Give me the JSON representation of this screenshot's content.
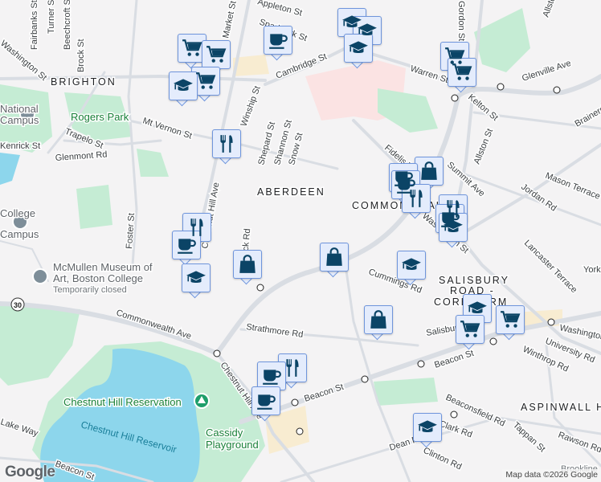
{
  "neighborhoods": {
    "brighton": "BRIGHTON",
    "aberdeen": "ABERDEEN",
    "commonwealth": "COMMONWEALTH",
    "salisbury_1": "SALISBURY",
    "salisbury_2": "ROAD -",
    "salisbury_3": "CORE FARM",
    "aspinwall": "ASPINWALL HILL",
    "brookline": "Brookline"
  },
  "streets": {
    "fairbanks": "Fairbanks St",
    "turner": "Turner St",
    "beechcroft": "Beechcroft St",
    "brock": "Brock St",
    "market": "Market St",
    "sparhawk": "Sparhawk St",
    "appleton": "Appleton St",
    "cambridge": "Cambridge St",
    "warren": "Warren St",
    "gordon": "Gordon St",
    "allston_top": "Allston St",
    "glenville": "Glenville Ave",
    "kelton": "Kelton St",
    "brainerd": "Brainerd Rd",
    "allston": "Allston St",
    "summit": "Summit Ave",
    "mason": "Mason Terrace",
    "jordan": "Jordan Rd",
    "lancaster": "Lancaster Terrace",
    "york": "York Ter",
    "washington": "Washington St",
    "washington2": "Washington St",
    "university": "University Rd",
    "winthrop": "Winthrop Rd",
    "tappan": "Tappan St",
    "rawson": "Rawson Rd",
    "beaconsfield": "Beaconsfield Rd",
    "dean": "Dean Rd",
    "clark": "Clark Rd",
    "clinton": "Clinton Rd",
    "beacon1": "Beacon St",
    "beacon2": "Beacon St",
    "beacon3": "Beacon St",
    "cummings": "Cummings Rd",
    "salisbury_rd": "Salisbury Rd",
    "strathmore": "Strathmore Rd",
    "commonwealth_ave": "Commonwealth Ave",
    "chestnut_hill_ave": "Chestnut Hill Ave",
    "chestnut_hill_ave2": "Chestnut Hill Ave",
    "winship": "Winship St",
    "shepard": "Shepard St",
    "shannon": "Shannon St",
    "snow": "Snow St",
    "mt_vernon": "Mt Vernon St",
    "trapelo": "Trapelo St",
    "kenrick": "Kenrick St",
    "glenmont": "Glenmont Rd",
    "foster": "Foster St",
    "washington_st_left": "Washington St",
    "chiswick": "Chiswick Rd",
    "fidelis": "Fidelis Way",
    "route": "30",
    "lake_way": "Lake Way"
  },
  "pois": {
    "rogers_park": "Rogers Park",
    "mcmullen_1": "McMullen Museum of",
    "mcmullen_2": "Art, Boston College",
    "mcmullen_status": "Temporarily closed",
    "reservation": "Chestnut Hill Reservation",
    "reservoir": "Chestnut Hill Reservoir",
    "cassidy_1": "Cassidy",
    "cassidy_2": "Playground",
    "campus1_a": "National",
    "campus1_b": "Campus",
    "campus2_a": "College",
    "campus2_b": "Campus"
  },
  "markers": [
    "cart",
    "cart",
    "cart",
    "graduation-cap",
    "coffee",
    "restaurant",
    "graduation-cap",
    "graduation-cap",
    "graduation-cap",
    "cart",
    "cart",
    "shopping-bag",
    "coffee",
    "coffee",
    "restaurant",
    "restaurant",
    "coffee",
    "graduation-cap",
    "shopping-bag",
    "shopping-bag",
    "graduation-cap",
    "graduation-cap",
    "cart",
    "cart",
    "shopping-bag",
    "restaurant",
    "coffee",
    "graduation-cap",
    "restaurant",
    "coffee",
    "coffee",
    "graduation-cap"
  ],
  "colors": {
    "marker_fill": "#e4ecfc",
    "marker_border": "#6f95dc",
    "icon": "#0b4466",
    "park": "#c5ecd4",
    "water": "#8dd6ec",
    "road": "#d9dde3",
    "hospital": "#fbe3e3"
  },
  "footer": {
    "logo": "Google",
    "attribution": "Map data ©2026 Google"
  }
}
